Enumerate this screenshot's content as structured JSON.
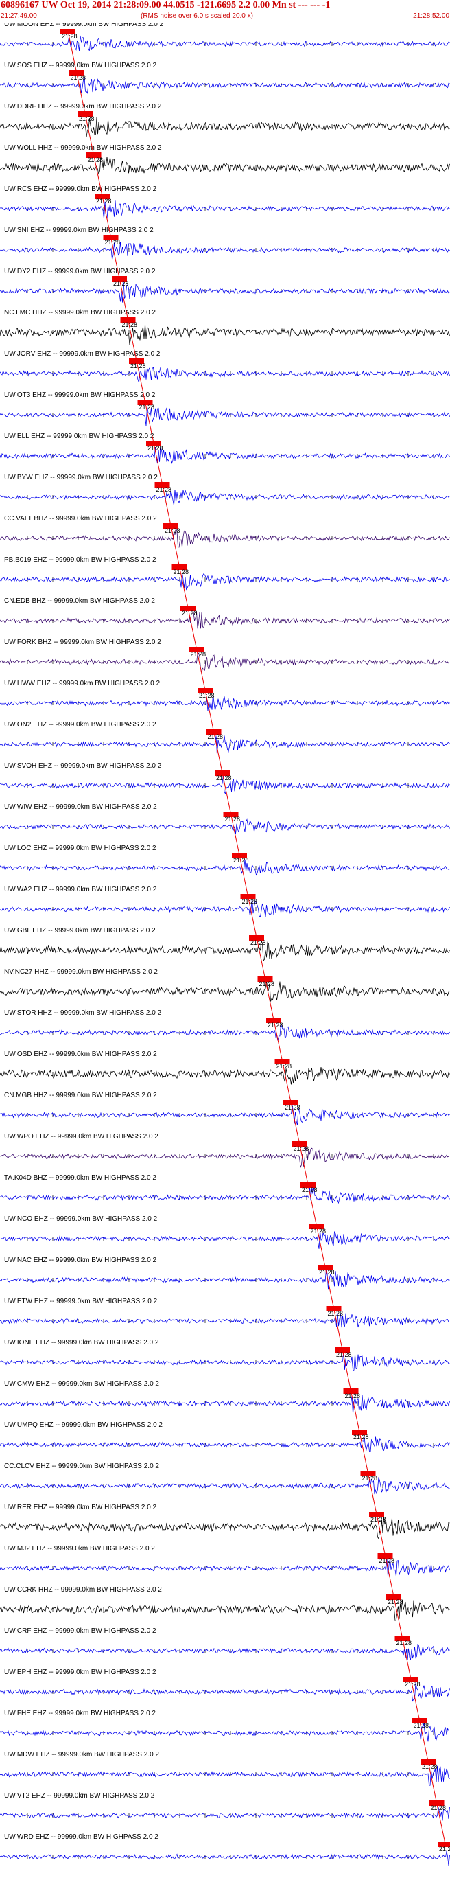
{
  "header": {
    "title": "60896167 UW Oct 19, 2014 21:28:09.00   44.0515 -121.6695  2.2 0.00 Mn st --- --- -1",
    "subtitle": "(RMS noise over 6.0 s scaled 20.0 x)",
    "start_time": "21:27:49.00",
    "end_time": "21:28:52.00"
  },
  "pick_label": "21:28",
  "filter_label": "-- 99999.0km BW  HIGHPASS  2.0  2",
  "colors": {
    "blue": "#0000ee",
    "black": "#000000",
    "purple": "#3a0a6e",
    "red": "#ee0000"
  },
  "traces": [
    {
      "station": "UW.MOON EHZ",
      "color": "blue"
    },
    {
      "station": "UW.SOS EHZ",
      "color": "blue"
    },
    {
      "station": "UW.DDRF HHZ",
      "color": "black"
    },
    {
      "station": "UW.WOLL HHZ",
      "color": "black"
    },
    {
      "station": "UW.RCS EHZ",
      "color": "blue"
    },
    {
      "station": "UW.SNI EHZ",
      "color": "blue"
    },
    {
      "station": "UW.DY2 EHZ",
      "color": "blue"
    },
    {
      "station": "NC.LMC HHZ",
      "color": "black"
    },
    {
      "station": "UW.JORV EHZ",
      "color": "blue"
    },
    {
      "station": "UW.OT3 EHZ",
      "color": "blue"
    },
    {
      "station": "UW.ELL EHZ",
      "color": "blue"
    },
    {
      "station": "UW.BYW EHZ",
      "color": "blue"
    },
    {
      "station": "CC.VALT BHZ",
      "color": "purple"
    },
    {
      "station": "PB.B019 EHZ",
      "color": "blue"
    },
    {
      "station": "CN.EDB BHZ",
      "color": "purple"
    },
    {
      "station": "UW.FORK BHZ",
      "color": "purple"
    },
    {
      "station": "UW.HWW EHZ",
      "color": "blue"
    },
    {
      "station": "UW.ON2 EHZ",
      "color": "blue"
    },
    {
      "station": "UW.SVOH EHZ",
      "color": "blue"
    },
    {
      "station": "UW.WIW EHZ",
      "color": "blue"
    },
    {
      "station": "UW.LOC EHZ",
      "color": "blue"
    },
    {
      "station": "UW.WA2 EHZ",
      "color": "blue"
    },
    {
      "station": "UW.GBL EHZ",
      "color": "black"
    },
    {
      "station": "NV.NC27 HHZ",
      "color": "black"
    },
    {
      "station": "UW.STOR HHZ",
      "color": "blue"
    },
    {
      "station": "UW.OSD EHZ",
      "color": "black"
    },
    {
      "station": "CN.MGB HHZ",
      "color": "blue"
    },
    {
      "station": "UW.WPO EHZ",
      "color": "purple"
    },
    {
      "station": "TA.K04D BHZ",
      "color": "blue"
    },
    {
      "station": "UW.NCO EHZ",
      "color": "blue"
    },
    {
      "station": "UW.NAC EHZ",
      "color": "blue"
    },
    {
      "station": "UW.ETW EHZ",
      "color": "blue"
    },
    {
      "station": "UW.IONE EHZ",
      "color": "blue"
    },
    {
      "station": "UW.CMW EHZ",
      "color": "blue"
    },
    {
      "station": "UW.UMPQ EHZ",
      "color": "blue"
    },
    {
      "station": "CC.CLCV EHZ",
      "color": "blue"
    },
    {
      "station": "UW.RER EHZ",
      "color": "black"
    },
    {
      "station": "UW.MJ2 EHZ",
      "color": "blue"
    },
    {
      "station": "UW.CCRK HHZ",
      "color": "black"
    },
    {
      "station": "UW.CRF EHZ",
      "color": "blue"
    },
    {
      "station": "UW.EPH EHZ",
      "color": "blue"
    },
    {
      "station": "UW.FHE EHZ",
      "color": "blue"
    },
    {
      "station": "UW.MDW EHZ",
      "color": "blue"
    },
    {
      "station": "UW.VT2 EHZ",
      "color": "blue"
    },
    {
      "station": "UW.WRD EHZ",
      "color": "blue"
    }
  ]
}
